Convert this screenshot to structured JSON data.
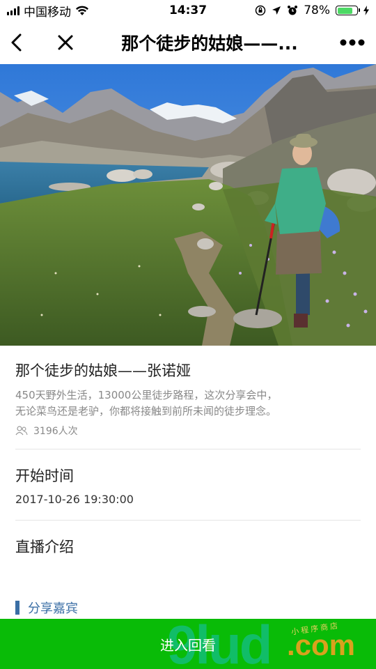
{
  "status_bar": {
    "carrier": "中国移动",
    "time": "14:37",
    "battery_percent": "78%",
    "battery_level": 0.78
  },
  "nav": {
    "title": "那个徒步的姑娘——..."
  },
  "event": {
    "title": "那个徒步的姑娘——张诺娅",
    "description_line1": "450天野外生活，13000公里徒步路程，这次分享会中，",
    "description_line2": "无论菜鸟还是老驴，你都将接触到前所未闻的徒步理念。",
    "views": "3196人次"
  },
  "start": {
    "label": "开始时间",
    "value": "2017-10-26 19:30:00"
  },
  "intro": {
    "label": "直播介绍"
  },
  "guests": {
    "label": "分享嘉宾"
  },
  "action": {
    "label": "进入回看"
  },
  "watermark": {
    "main": "9lud",
    "suffix": ".com",
    "small": "小 程 序 商 店"
  },
  "colors": {
    "primary_button": "#09bb07",
    "accent": "#3a6ea5"
  }
}
